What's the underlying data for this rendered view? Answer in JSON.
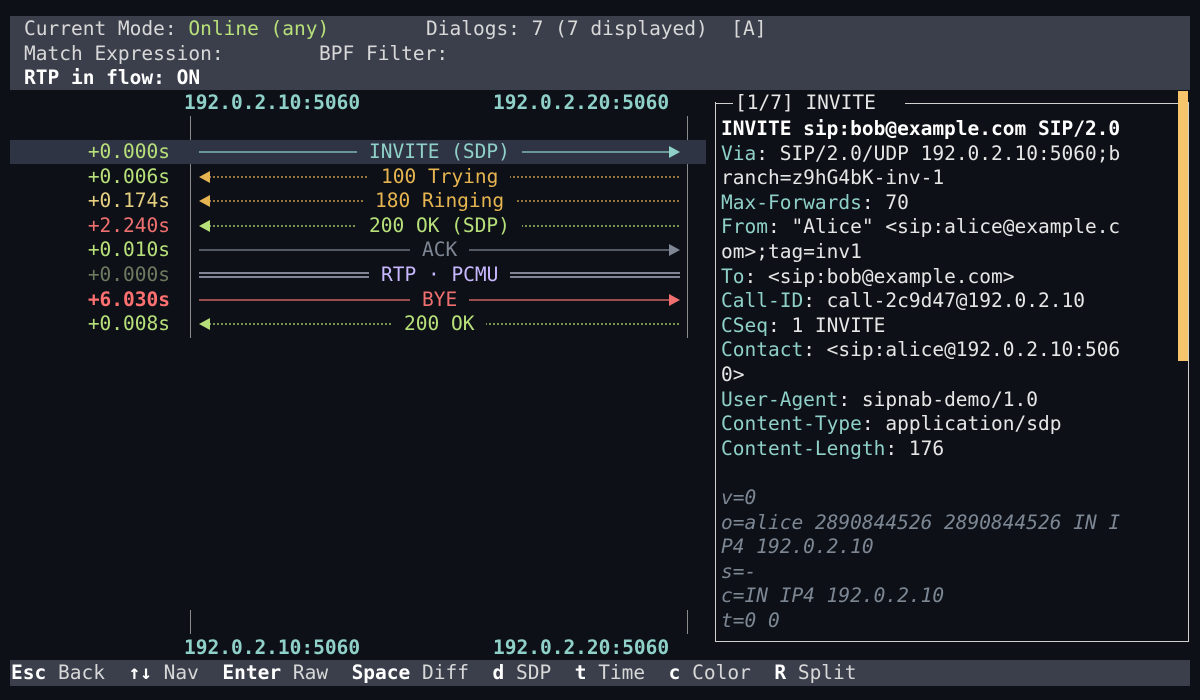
{
  "header": {
    "mode_label": "Current Mode:",
    "mode_value": "Online (any)",
    "dialogs_label": "Dialogs:",
    "dialogs_value": "7 (7 displayed)",
    "dialogs_flag": "[A]",
    "match_label": "Match Expression:",
    "bpf_label": "BPF Filter:",
    "rtp_label": "RTP in flow: ON"
  },
  "hosts": {
    "left": "192.0.2.10:5060",
    "right": "192.0.2.20:5060"
  },
  "flow": [
    {
      "time": "+0.000s",
      "label": "INVITE (SDP)",
      "direction": "right",
      "style": "solid",
      "color": "#8fd0c8",
      "time_color": "#b8e07a",
      "selected": true
    },
    {
      "time": "+0.006s",
      "label": "100 Trying",
      "direction": "left",
      "style": "dashed",
      "color": "#e6b450",
      "time_color": "#b8e07a"
    },
    {
      "time": "+0.174s",
      "label": "180 Ringing",
      "direction": "left",
      "style": "dashed",
      "color": "#e6b450",
      "time_color": "#e6d080"
    },
    {
      "time": "+2.240s",
      "label": "200 OK (SDP)",
      "direction": "left",
      "style": "dashed",
      "color": "#b8e07a",
      "time_color": "#f07070"
    },
    {
      "time": "+0.010s",
      "label": "ACK",
      "direction": "right",
      "style": "solid",
      "color": "#7f8694",
      "time_color": "#b8e07a"
    },
    {
      "time": "+0.000s",
      "label": "RTP · PCMU",
      "direction": "none",
      "style": "double",
      "color": "#c8b8ff",
      "time_color": "#6e7a60"
    },
    {
      "time": "+6.030s",
      "label": "BYE",
      "direction": "right",
      "style": "solid",
      "color": "#f07070",
      "time_color": "#ff7070",
      "bold_time": true
    },
    {
      "time": "+0.008s",
      "label": "200 OK",
      "direction": "left",
      "style": "dashed",
      "color": "#b8e07a",
      "time_color": "#b8e07a"
    }
  ],
  "panel": {
    "title": "[1/7] INVITE",
    "request_line": "INVITE sip:bob@example.com SIP/2.0",
    "headers": [
      {
        "key": "Via",
        "value": "SIP/2.0/UDP 192.0.2.10:5060;b"
      },
      {
        "key": "",
        "value": "ranch=z9hG4bK-inv-1"
      },
      {
        "key": "Max-Forwards",
        "value": "70"
      },
      {
        "key": "From",
        "value": "\"Alice\" <sip:alice@example.c"
      },
      {
        "key": "",
        "value": "om>;tag=inv1"
      },
      {
        "key": "To",
        "value": "<sip:bob@example.com>"
      },
      {
        "key": "Call-ID",
        "value": "call-2c9d47@192.0.2.10"
      },
      {
        "key": "CSeq",
        "value": "1 INVITE"
      },
      {
        "key": "Contact",
        "value": "<sip:alice@192.0.2.10:506"
      },
      {
        "key": "",
        "value": "0>"
      },
      {
        "key": "User-Agent",
        "value": "sipnab-demo/1.0"
      },
      {
        "key": "Content-Type",
        "value": "application/sdp"
      },
      {
        "key": "Content-Length",
        "value": "176"
      }
    ],
    "sdp": [
      "v=0",
      "o=alice 2890844526 2890844526 IN I",
      "P4 192.0.2.10",
      "s=-",
      "c=IN IP4 192.0.2.10",
      "t=0 0"
    ]
  },
  "footer": [
    {
      "key": "Esc",
      "label": "Back"
    },
    {
      "key": "↑↓",
      "label": "Nav"
    },
    {
      "key": "Enter",
      "label": "Raw"
    },
    {
      "key": "Space",
      "label": "Diff"
    },
    {
      "key": "d",
      "label": "SDP"
    },
    {
      "key": "t",
      "label": "Time"
    },
    {
      "key": "c",
      "label": "Color"
    },
    {
      "key": "R",
      "label": "Split"
    }
  ]
}
